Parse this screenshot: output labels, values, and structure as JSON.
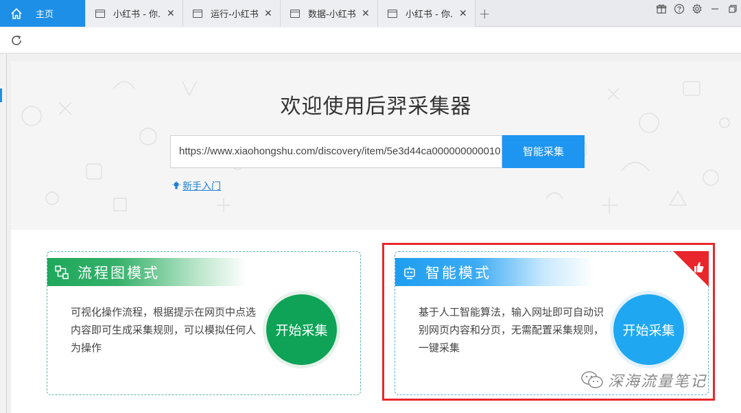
{
  "tabs": [
    {
      "label": "主页",
      "active": true
    },
    {
      "label": "小红书 - 你...",
      "active": false
    },
    {
      "label": "运行-小红书...",
      "active": false
    },
    {
      "label": "数据-小红书...",
      "active": false
    },
    {
      "label": "小红书 - 你...",
      "active": false
    }
  ],
  "new_tab": "+",
  "hero": {
    "title": "欢迎使用后羿采集器",
    "url_value": "https://www.xiaohongshu.com/discovery/item/5e3d44ca000000000010",
    "smart_button": "智能采集",
    "guide_link": "新手入门"
  },
  "cards": {
    "flow": {
      "title": "流程图模式",
      "description": "可视化操作流程，根据提示在网页中点选内容即可生成采集规则，可以模拟任何人为操作",
      "button": "开始采集"
    },
    "smart": {
      "title": "智能模式",
      "description": "基于人工智能算法，输入网址即可自动识别网页内容和分页，无需配置采集规则，一键采集",
      "button": "开始采集"
    }
  },
  "watermark": "深海流量笔记",
  "colors": {
    "accent_blue": "#1d8fe6",
    "flow_green": "#0ea357",
    "smart_blue": "#1fa8f1",
    "highlight_red": "#e8262b"
  },
  "icons": {
    "home": "home-icon",
    "refresh": "refresh-icon",
    "gift": "gift-icon",
    "help": "help-icon",
    "settings": "gear-icon",
    "minimize": "minimize-icon",
    "restore": "restore-icon",
    "flow_mode": "flowchart-icon",
    "smart_mode": "robot-icon",
    "recommend": "thumbs-up-icon",
    "guide": "lightbulb-icon"
  }
}
